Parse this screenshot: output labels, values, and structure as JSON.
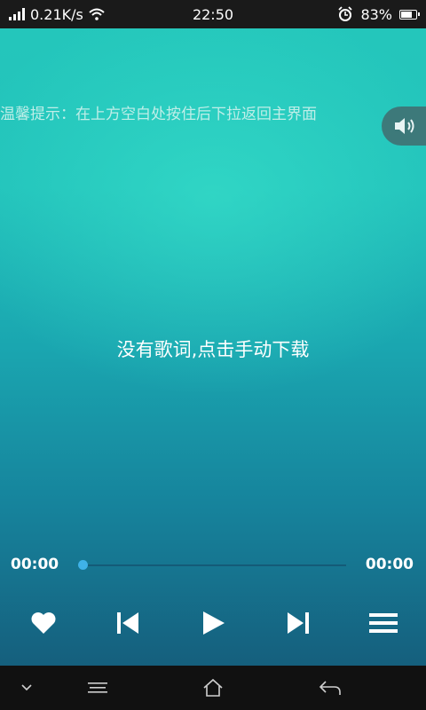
{
  "status_bar": {
    "network_speed": "0.21K/s",
    "time": "22:50",
    "battery_percent": "83%",
    "battery_level": 0.83,
    "icons": [
      "signal-icon",
      "wifi-icon",
      "alarm-icon",
      "battery-icon"
    ]
  },
  "player": {
    "hint": "温馨提示：在上方空白处按住后下拉返回主界面",
    "lyrics_placeholder": "没有歌词,点击手动下载",
    "current_time": "00:00",
    "total_time": "00:00",
    "progress": 0.0
  },
  "controls": {
    "icons": [
      "heart-icon",
      "previous-icon",
      "play-icon",
      "next-icon",
      "menu-icon"
    ]
  },
  "nav_bar": {
    "icons": [
      "chevron-down-icon",
      "menu-icon",
      "home-icon",
      "back-icon"
    ]
  },
  "colors": {
    "gradient_top": "#24c6bb",
    "gradient_bottom": "#155f7d",
    "progress_knob": "#3fb2e8",
    "status_bar_bg": "#1a1a1a"
  }
}
